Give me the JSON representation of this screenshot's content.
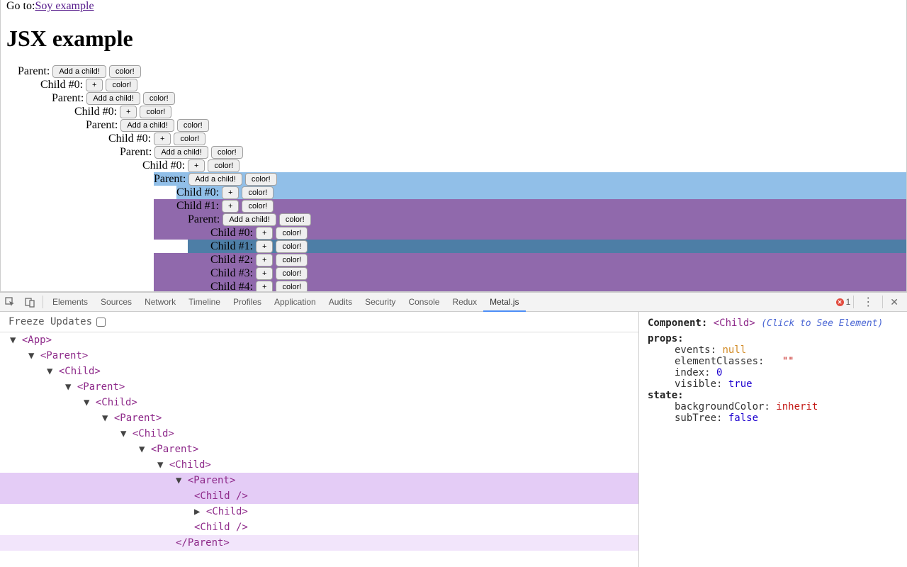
{
  "goto_prefix": "Go to:",
  "goto_link": "Soy example",
  "heading": "JSX example",
  "labels": {
    "parent": "Parent:",
    "add_child": "Add a child!",
    "color": "color!",
    "plus": "+"
  },
  "rows": [
    {
      "indent": 24,
      "label": "Parent:",
      "btns": [
        "add",
        "color"
      ],
      "bg": ""
    },
    {
      "indent": 56,
      "label": "Child #0:",
      "btns": [
        "plus",
        "color"
      ],
      "bg": ""
    },
    {
      "indent": 72,
      "label": "Parent:",
      "btns": [
        "add",
        "color"
      ],
      "bg": ""
    },
    {
      "indent": 104,
      "label": "Child #0:",
      "btns": [
        "plus",
        "color"
      ],
      "bg": ""
    },
    {
      "indent": 120,
      "label": "Parent:",
      "btns": [
        "add",
        "color"
      ],
      "bg": ""
    },
    {
      "indent": 152,
      "label": "Child #0:",
      "btns": [
        "plus",
        "color"
      ],
      "bg": ""
    },
    {
      "indent": 168,
      "label": "Parent:",
      "btns": [
        "add",
        "color"
      ],
      "bg": ""
    },
    {
      "indent": 200,
      "label": "Child #0:",
      "btns": [
        "plus",
        "color"
      ],
      "bg": ""
    },
    {
      "indent": 216,
      "label": "Parent:",
      "btns": [
        "add",
        "color"
      ],
      "bg": "blue"
    },
    {
      "indent": 248,
      "label": "Child #0:",
      "btns": [
        "plus",
        "color"
      ],
      "bg": "blue"
    },
    {
      "indent": 248,
      "label": "Child #1:",
      "btns": [
        "plus",
        "color"
      ],
      "bg": "purple",
      "from": 216
    },
    {
      "indent": 264,
      "label": "Parent:",
      "btns": [
        "add",
        "color"
      ],
      "bg": "purple",
      "from": 216
    },
    {
      "indent": 296,
      "label": "Child #0:",
      "btns": [
        "plus",
        "color"
      ],
      "bg": "purple",
      "from": 216
    },
    {
      "indent": 296,
      "label": "Child #1:",
      "btns": [
        "plus",
        "color"
      ],
      "bg": "darkblue",
      "from": 264
    },
    {
      "indent": 296,
      "label": "Child #2:",
      "btns": [
        "plus",
        "color"
      ],
      "bg": "purple",
      "from": 216
    },
    {
      "indent": 296,
      "label": "Child #3:",
      "btns": [
        "plus",
        "color"
      ],
      "bg": "purple",
      "from": 216
    },
    {
      "indent": 296,
      "label": "Child #4:",
      "btns": [
        "plus",
        "color"
      ],
      "bg": "purple",
      "from": 216
    }
  ],
  "devtools": {
    "tabs": [
      "Elements",
      "Sources",
      "Network",
      "Timeline",
      "Profiles",
      "Application",
      "Audits",
      "Security",
      "Console",
      "Redux",
      "Metal.js"
    ],
    "active_tab": "Metal.js",
    "error_count": "1"
  },
  "freeze_label": "Freeze Updates",
  "tree": [
    {
      "indent": 14,
      "tw": "▼",
      "text": "<App>",
      "hl": ""
    },
    {
      "indent": 40,
      "tw": "▼",
      "text": "<Parent>",
      "hl": ""
    },
    {
      "indent": 66,
      "tw": "▼",
      "text": "<Child>",
      "hl": ""
    },
    {
      "indent": 92,
      "tw": "▼",
      "text": "<Parent>",
      "hl": ""
    },
    {
      "indent": 118,
      "tw": "▼",
      "text": "<Child>",
      "hl": ""
    },
    {
      "indent": 144,
      "tw": "▼",
      "text": "<Parent>",
      "hl": ""
    },
    {
      "indent": 170,
      "tw": "▼",
      "text": "<Child>",
      "hl": ""
    },
    {
      "indent": 196,
      "tw": "▼",
      "text": "<Parent>",
      "hl": ""
    },
    {
      "indent": 222,
      "tw": "▼",
      "text": "<Child>",
      "hl": ""
    },
    {
      "indent": 248,
      "tw": "▼",
      "text": "<Parent>",
      "hl": "hl1"
    },
    {
      "indent": 274,
      "tw": "",
      "text": "<Child />",
      "hl": "hl1"
    },
    {
      "indent": 274,
      "tw": "▶",
      "text": "<Child>",
      "hl": ""
    },
    {
      "indent": 274,
      "tw": "",
      "text": "<Child />",
      "hl": ""
    },
    {
      "indent": 248,
      "tw": "",
      "text": "</Parent>",
      "hl": "hl2"
    }
  ],
  "detail": {
    "header_label": "Component:",
    "header_tag": "<Child>",
    "hint": "(Click to See Element)",
    "props_label": "props:",
    "props": [
      {
        "k": "events:",
        "v": "null",
        "cls": "pnull"
      },
      {
        "k": "elementClasses:",
        "v": "\"\"",
        "cls": "pstr",
        "pad": true
      },
      {
        "k": "index:",
        "v": "0",
        "cls": "pnum"
      },
      {
        "k": "visible:",
        "v": "true",
        "cls": "pbool"
      }
    ],
    "state_label": "state:",
    "state": [
      {
        "k": "backgroundColor:",
        "v": "inherit",
        "cls": "pstr"
      },
      {
        "k": "subTree:",
        "v": "false",
        "cls": "pbool"
      }
    ]
  }
}
